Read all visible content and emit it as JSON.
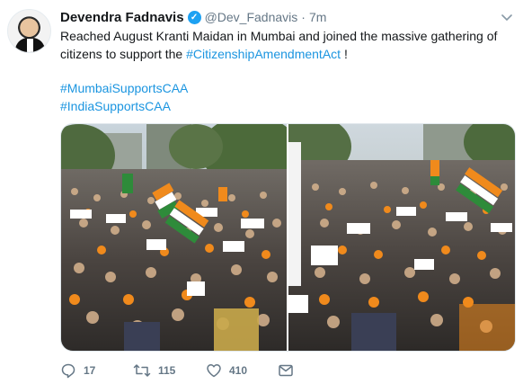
{
  "tweet": {
    "author_name": "Devendra Fadnavis",
    "verified_badge": "✓",
    "handle": "@Dev_Fadnavis",
    "separator": "·",
    "time": "7m",
    "caret_icon": "chevron-down",
    "text_main": "Reached August Kranti Maidan in Mumbai and joined the massive gathering of citizens to support the ",
    "text_link": "#CitizenshipAmendmentAct",
    "text_end": " !",
    "hashtags": [
      "#MumbaiSupportsCAA",
      "#IndiaSupportsCAA"
    ],
    "media_count": 2
  },
  "actions": {
    "reply_count": "17",
    "retweet_count": "115",
    "like_count": "410"
  },
  "colors": {
    "link": "#1b95e0",
    "verified": "#1da1f2",
    "muted": "#657786",
    "text": "#14171a"
  }
}
